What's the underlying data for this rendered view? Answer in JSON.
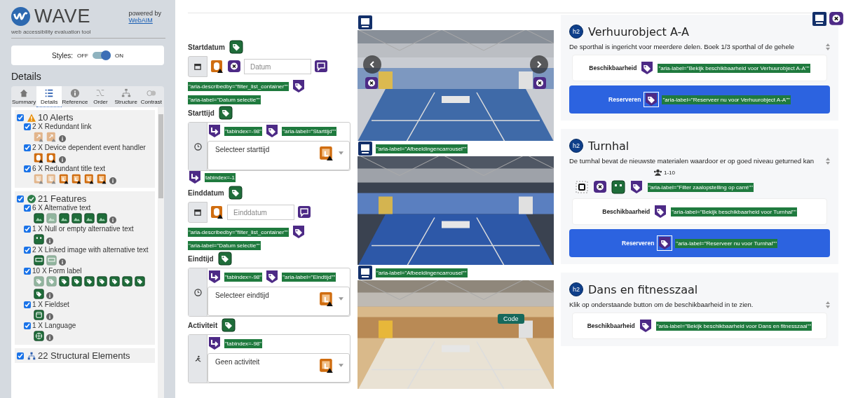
{
  "wave": {
    "logo": "WAVE",
    "tagline": "web accessibility evaluation tool",
    "powered": "powered by",
    "link": "WebAIM",
    "styles": {
      "label": "Styles:",
      "off": "OFF",
      "on_label": "ON",
      "on": true
    },
    "heading": "Details",
    "tabs": [
      {
        "label": "Summary",
        "selected": false
      },
      {
        "label": "Details",
        "selected": true
      },
      {
        "label": "Reference",
        "selected": false
      },
      {
        "label": "Order",
        "selected": false
      },
      {
        "label": "Structure",
        "selected": false
      },
      {
        "label": "Contrast",
        "selected": false
      }
    ],
    "groups": [
      {
        "kind": "alert",
        "title": "10 Alerts",
        "checked": true,
        "items": [
          {
            "label": "2 X Redundant link",
            "kind": "redundant-link",
            "checked": true,
            "icons": [
              {
                "faded": true
              },
              {
                "faded": true
              }
            ]
          },
          {
            "label": "2 X Device dependent event handler",
            "kind": "device-handler",
            "checked": true,
            "icons": [
              {
                "faded": false
              },
              {
                "faded": false
              }
            ]
          },
          {
            "label": "6 X Redundant title text",
            "kind": "redundant-title",
            "checked": true,
            "icons": [
              {
                "faded": true
              },
              {
                "faded": true
              },
              {
                "faded": false
              },
              {
                "faded": false
              },
              {
                "faded": false
              },
              {
                "faded": false
              }
            ]
          }
        ]
      },
      {
        "kind": "feature",
        "title": "21 Features",
        "checked": true,
        "items": [
          {
            "label": "6 X Alternative text",
            "kind": "alt-text",
            "checked": true,
            "icons": [
              {
                "faded": false
              },
              {
                "faded": true
              },
              {
                "faded": false
              },
              {
                "faded": false
              },
              {
                "faded": false
              },
              {
                "faded": false
              }
            ]
          },
          {
            "label": "1 X Null or empty alternative text",
            "kind": "null-alt",
            "checked": true,
            "icons": [
              {
                "faded": false
              }
            ]
          },
          {
            "label": "2 X Linked image with alternative text",
            "kind": "linked-alt",
            "checked": true,
            "icons": [
              {
                "faded": false
              },
              {
                "faded": true
              }
            ]
          },
          {
            "label": "10 X Form label",
            "kind": "form-label",
            "checked": true,
            "icons": [
              {
                "faded": true
              },
              {
                "faded": true
              },
              {
                "faded": false
              },
              {
                "faded": false
              },
              {
                "faded": false
              },
              {
                "faded": false
              },
              {
                "faded": false
              },
              {
                "faded": false
              },
              {
                "faded": false
              },
              {
                "faded": false
              }
            ]
          },
          {
            "label": "1 X Fieldset",
            "kind": "fieldset",
            "checked": true,
            "icons": [
              {
                "faded": false
              }
            ]
          },
          {
            "label": "1 X Language",
            "kind": "language",
            "checked": true,
            "icons": [
              {
                "faded": false
              }
            ]
          }
        ]
      },
      {
        "kind": "structure",
        "title": "22 Structural Elements",
        "checked": true
      }
    ]
  },
  "form": [
    {
      "label": "Startdatum",
      "kind": "date",
      "placeholder": "Datum",
      "pre": [
        {
          "kind": "mouse"
        },
        {
          "kind": "xbubble"
        }
      ],
      "post": [
        {
          "kind": "title"
        }
      ],
      "notes": [
        {
          "kind": "aria-text",
          "text": "\"aria-describedby=\"filter_list_container\"\""
        },
        {
          "kind": "aria"
        },
        {
          "kind": "aria-text",
          "text": "\"aria-label=\"Datum selectie\"\""
        }
      ]
    },
    {
      "label": "Starttijd",
      "kind": "select",
      "value": "Selecteer starttijd",
      "notes": [
        {
          "kind": "tabindex"
        },
        {
          "kind": "aria-text",
          "text": "\"tabindex=-98\""
        },
        {
          "kind": "aria"
        },
        {
          "kind": "aria-text",
          "text": "\"aria-label=\"Starttijd\"\""
        }
      ],
      "after": [
        {
          "kind": "tabindex"
        },
        {
          "kind": "aria-text",
          "text": "tabindex=-1"
        }
      ]
    },
    {
      "label": "Einddatum",
      "kind": "date",
      "placeholder": "Einddatum",
      "pre": [
        {
          "kind": "mouse"
        }
      ],
      "post": [
        {
          "kind": "title"
        }
      ],
      "notes": [
        {
          "kind": "aria-text",
          "text": "\"aria-describedby=\"filter_list_container\"\""
        },
        {
          "kind": "aria"
        },
        {
          "kind": "aria-text",
          "text": "\"aria-label=\"Datum selectie\"\""
        }
      ]
    },
    {
      "label": "Eindtijd",
      "kind": "select",
      "value": "Selecteer eindtijd",
      "notes": [
        {
          "kind": "tabindex"
        },
        {
          "kind": "aria-text",
          "text": "\"tabindex=-98\""
        },
        {
          "kind": "aria"
        },
        {
          "kind": "aria-text",
          "text": "\"aria-label=\"Eindtijd\"\""
        }
      ]
    },
    {
      "label": "Activiteit",
      "kind": "activity",
      "value": "Geen activiteit",
      "notes": [
        {
          "kind": "tabindex"
        },
        {
          "kind": "aria-text",
          "text": "\"tabindex=-98\""
        }
      ]
    }
  ],
  "photos": [
    {
      "kind": "carousel"
    },
    {
      "kind": "picture",
      "caption": "\"aria-label=\"Afbeeldingencarrousel\"\""
    },
    {
      "kind": "picture",
      "caption": "\"aria-label=\"Afbeeldingencarrousel\"\"",
      "badge": "Code"
    }
  ],
  "cards": [
    {
      "level": "h2",
      "title": "Verhuurobject A-A",
      "text": "De sporthal is ingericht voor meerdere delen. Boek 1/3 sporthal of de gehele",
      "availability": "Beschikbaarheid",
      "availability_aria": "\"aria-label=\"Bekijk beschikbaarheid voor Verhuurobject A-A\"\"",
      "reserve": "Reserveren",
      "reserve_aria": "\"aria-label=\"Reserveer nu voor Verhuurobject A-A\"\""
    },
    {
      "level": "h2",
      "title": "Turnhal",
      "text": "De turnhal bevat de nieuwste materialen waardoor er op goed niveau geturned kan",
      "capacity": "1-10",
      "filter_aria": "\"aria-label=\"Filter zaalopstelling op carré\"\"",
      "availability": "Beschikbaarheid",
      "availability_aria": "\"aria-label=\"Bekijk beschikbaarheid voor Turnhal\"\"",
      "reserve": "Reserveren",
      "reserve_aria": "\"aria-label=\"Reserveer nu voor Turnhal\"\""
    },
    {
      "level": "h2",
      "title": "Dans en fitnesszaal",
      "text": "Klik op onderstaande button om de beschikbaarheid in te zien.",
      "availability": "Beschikbaarheid",
      "availability_aria": "\"aria-label=\"Bekijk beschikbaarheid voor Dans en fitnesszaal\"\""
    }
  ]
}
